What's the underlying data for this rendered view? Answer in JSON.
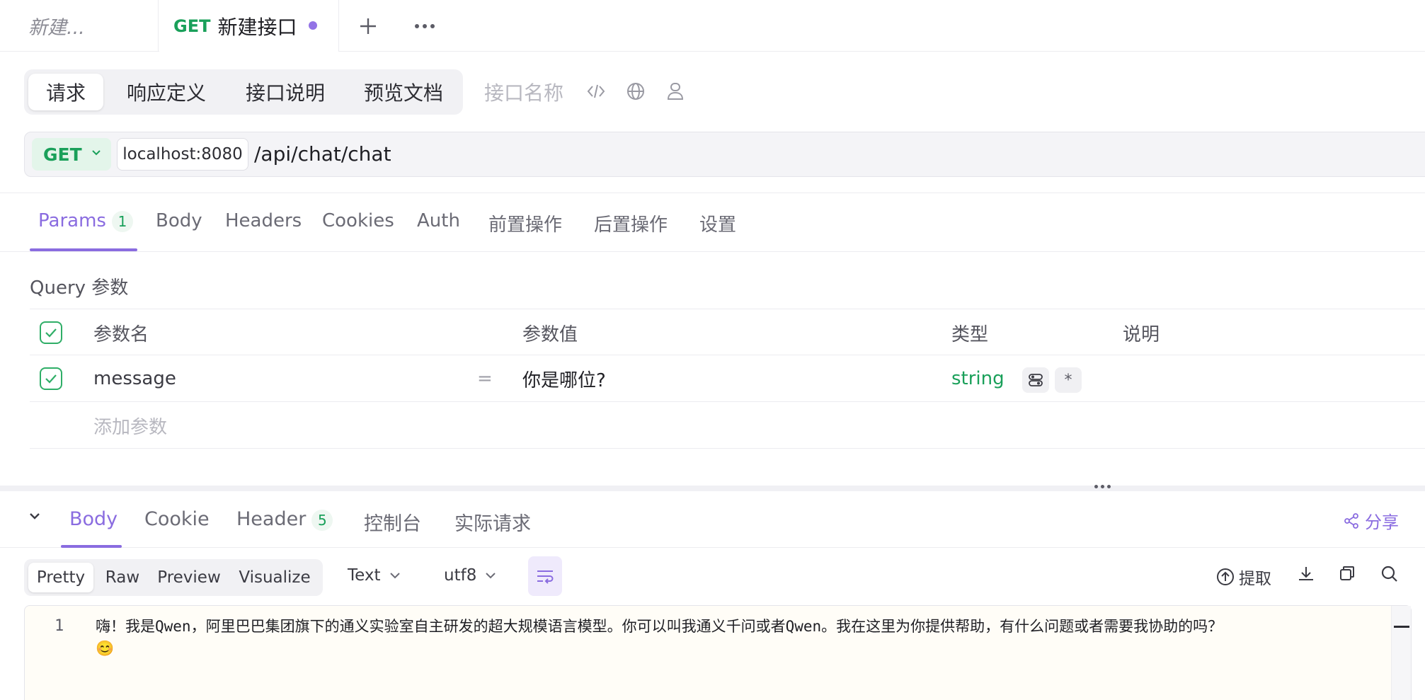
{
  "tabs": {
    "first_label": "新建...",
    "active_method": "GET",
    "active_title": "新建接口"
  },
  "nav": {
    "items": [
      "请求",
      "响应定义",
      "接口说明",
      "预览文档"
    ],
    "api_name_placeholder": "接口名称"
  },
  "url": {
    "method": "GET",
    "host": "localhost:8080",
    "path": "/api/chat/chat"
  },
  "request_tabs": {
    "params": "Params",
    "params_count": "1",
    "items": [
      "Body",
      "Headers",
      "Cookies",
      "Auth",
      "前置操作",
      "后置操作",
      "设置"
    ]
  },
  "query": {
    "title": "Query 参数",
    "headers": {
      "name": "参数名",
      "value": "参数值",
      "type": "类型",
      "desc": "说明"
    },
    "row": {
      "name": "message",
      "eq": "=",
      "value": "你是哪位?",
      "type": "string",
      "required": "*"
    },
    "add_placeholder": "添加参数"
  },
  "response": {
    "tabs": [
      "Body",
      "Cookie",
      "Header",
      "控制台",
      "实际请求"
    ],
    "header_count": "5",
    "share": "分享",
    "formats": [
      "Pretty",
      "Raw",
      "Preview",
      "Visualize"
    ],
    "content_type": "Text",
    "encoding": "utf8",
    "extract": "提取",
    "line_number": "1",
    "body_line1": "嗨！我是Qwen，阿里巴巴集团旗下的通义实验室自主研发的超大规模语言模型。你可以叫我通义千问或者Qwen。我在这里为你提供帮助，有什么问题或者需要我协助的吗？",
    "body_line2": "😊"
  },
  "colors": {
    "accent": "#8a6ce0",
    "get_green": "#1aa05a",
    "unsaved_dot": "#9373e6"
  },
  "icons": [
    "plus-icon",
    "more-icon",
    "code-icon",
    "globe-icon",
    "person-icon",
    "chevron-down-icon",
    "check-icon",
    "share-icon",
    "upload-icon",
    "download-icon",
    "copy-icon",
    "search-icon",
    "wrap-icon"
  ]
}
